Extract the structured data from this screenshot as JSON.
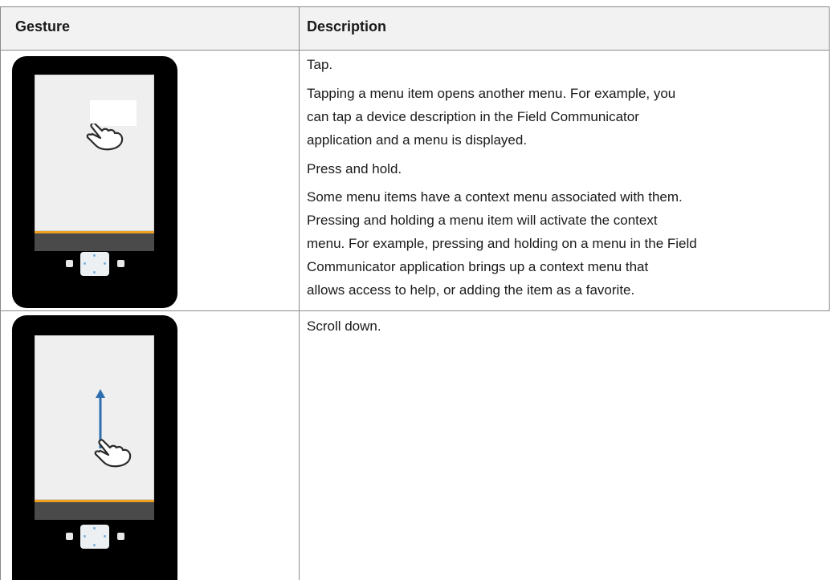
{
  "table": {
    "headers": {
      "gesture": "Gesture",
      "description": "Description"
    },
    "rows": [
      {
        "gesture_icon": "tap-gesture-icon",
        "description": [
          "Tap.",
          "Tapping a menu item opens another menu. For example, you",
          "can tap a device description in the Field Communicator",
          "application and a menu is displayed.",
          "Press and hold.",
          "Some menu items have a context menu associated with them.",
          "Pressing and holding a menu item will activate the context",
          "menu. For example, pressing and holding on a menu in the Field",
          "Communicator application brings up a context menu that",
          "allows access to help, or adding the item as a favorite."
        ]
      },
      {
        "gesture_icon": "scroll-down-gesture-icon",
        "description": [
          "Scroll down."
        ]
      }
    ]
  },
  "colors": {
    "device": "#000000",
    "accent": "#f0a020",
    "arrow": "#2f6fb0"
  }
}
